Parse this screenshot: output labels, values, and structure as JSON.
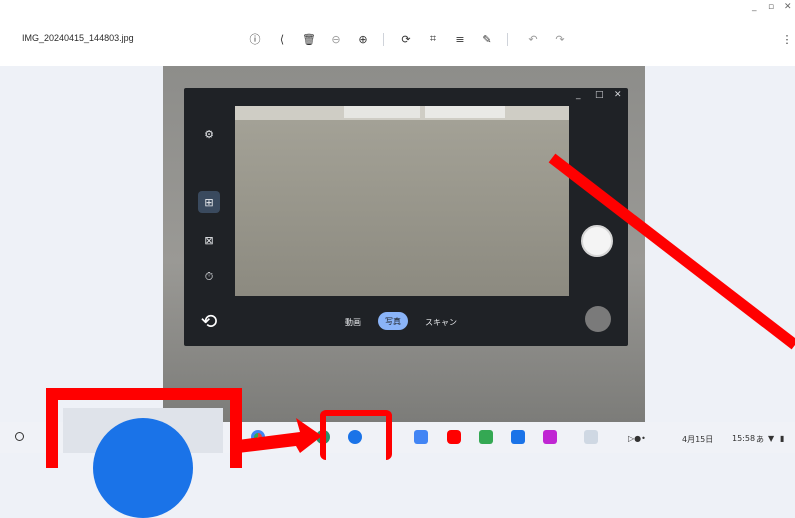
{
  "viewer": {
    "filename": "IMG_20240415_144803.jpg",
    "window_controls": [
      "_",
      "▫",
      "✕"
    ],
    "toolbar_icons": [
      "info-icon",
      "share-icon",
      "delete-icon",
      "zoom-out-icon",
      "zoom-in-icon",
      "rotate-icon",
      "crop-icon",
      "adjust-icon",
      "markup-icon",
      "undo-icon",
      "redo-icon",
      "more-icon"
    ]
  },
  "camera": {
    "window_controls": [
      "_",
      "□",
      "✕"
    ],
    "modes": {
      "video": "動画",
      "photo": "写真",
      "scan": "スキャン"
    }
  },
  "shelf": {
    "date": "4月15日",
    "time": "15:58",
    "ime": "あ"
  },
  "colors": {
    "annotation": "#ff0000",
    "accent": "#8ab4f8",
    "files_blue": "#1a73e8"
  }
}
